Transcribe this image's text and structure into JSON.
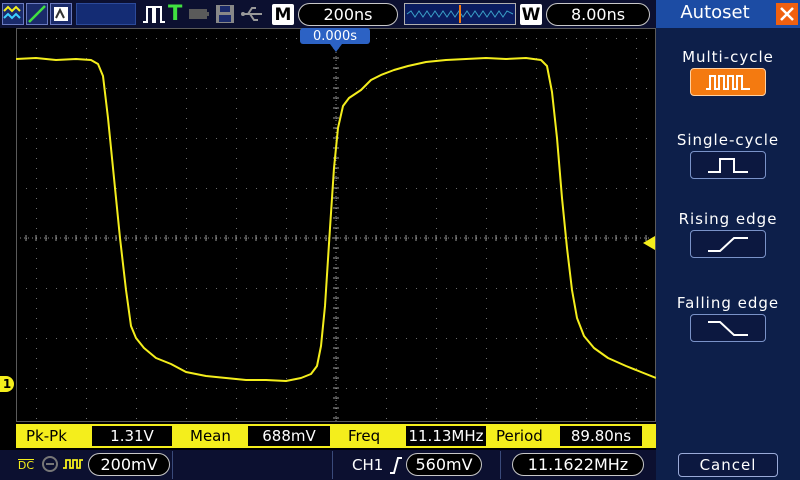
{
  "topbar": {
    "timebase_label": "M",
    "timebase_value": "200ns",
    "window_label": "W",
    "window_value": "8.00ns",
    "trigger_status": "T"
  },
  "screen": {
    "trigger_position": "0.000s",
    "channel_marker": "1"
  },
  "measurements": [
    {
      "label": "Pk-Pk",
      "value": "1.31V"
    },
    {
      "label": "Mean",
      "value": "688mV"
    },
    {
      "label": "Freq",
      "value": "11.13MHz"
    },
    {
      "label": "Period",
      "value": "89.80ns"
    }
  ],
  "bottombar": {
    "coupling": "DC",
    "volts_div": "200mV",
    "trigger_source": "CH1",
    "trigger_level": "560mV",
    "trigger_freq": "11.1622MHz"
  },
  "side_panel": {
    "title": "Autoset",
    "options": [
      {
        "label": "Multi-cycle",
        "active": true
      },
      {
        "label": "Single-cycle",
        "active": false
      },
      {
        "label": "Rising edge",
        "active": false
      },
      {
        "label": "Falling edge",
        "active": false
      }
    ],
    "cancel_label": "Cancel"
  },
  "colors": {
    "trace": "#f4ee1c",
    "accent": "#f47a10",
    "panel": "#0d1f4a"
  }
}
